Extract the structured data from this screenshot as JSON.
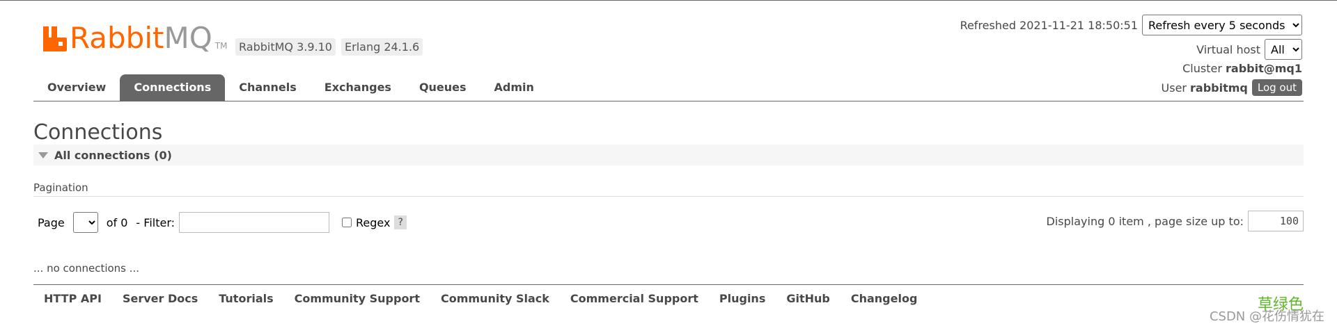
{
  "brand": {
    "rabbit": "Rabbit",
    "mq": "MQ",
    "tm": "TM",
    "accent_color": "#ff6600"
  },
  "versions": {
    "rabbitmq": "RabbitMQ 3.9.10",
    "erlang": "Erlang 24.1.6"
  },
  "header": {
    "refreshed_label": "Refreshed 2021-11-21 18:50:51",
    "refresh_select": "Refresh every 5 seconds",
    "vhost_label": "Virtual host",
    "vhost_select": "All",
    "cluster_label": "Cluster",
    "cluster_value": "rabbit@mq1",
    "user_label": "User",
    "user_value": "rabbitmq",
    "logout_label": "Log out"
  },
  "nav": {
    "tabs": [
      "Overview",
      "Connections",
      "Channels",
      "Exchanges",
      "Queues",
      "Admin"
    ],
    "active": "Connections"
  },
  "main": {
    "title": "Connections",
    "section_label": "All connections (0)",
    "pagination_label": "Pagination",
    "page_label": "Page",
    "page_select": "",
    "of_label": "of 0",
    "filter_label": "- Filter:",
    "filter_value": "",
    "regex_label": "Regex",
    "help_label": "?",
    "displaying_label": "Displaying 0 item , page size up to:",
    "page_size": "100",
    "empty_message": "... no connections ..."
  },
  "footer": {
    "links": [
      "HTTP API",
      "Server Docs",
      "Tutorials",
      "Community Support",
      "Community Slack",
      "Commercial Support",
      "Plugins",
      "GitHub",
      "Changelog"
    ]
  },
  "watermark": {
    "green_text": "草绿色",
    "csdn_text": "CSDN @花伤情犹在"
  }
}
